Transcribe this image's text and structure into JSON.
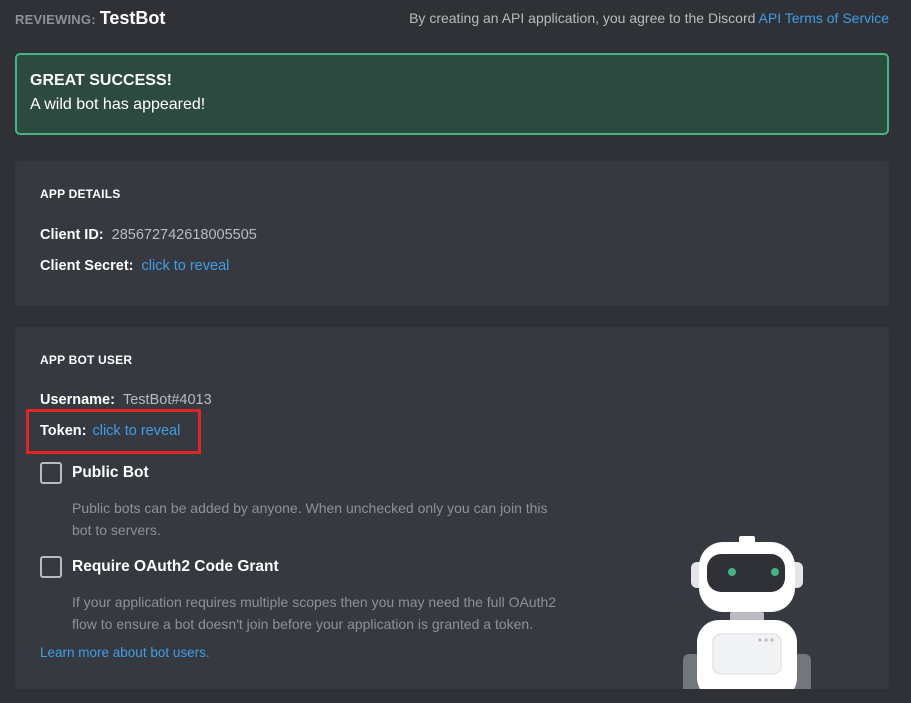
{
  "header": {
    "reviewing_label": "REVIEWING:",
    "app_name": "TestBot",
    "notice_prefix": "By creating an API application, you agree to the Discord",
    "terms_link": "API Terms of Service"
  },
  "success": {
    "title": "GREAT SUCCESS!",
    "message": "A wild bot has appeared!"
  },
  "app_details": {
    "title": "APP DETAILS",
    "client_id_label": "Client ID:",
    "client_id_value": "285672742618005505",
    "client_secret_label": "Client Secret:",
    "client_secret_link": "click to reveal"
  },
  "bot_user": {
    "title": "APP BOT USER",
    "username_label": "Username:",
    "username_value": "TestBot#4013",
    "token_label": "Token:",
    "token_link": "click to reveal",
    "public_bot_label": "Public Bot",
    "public_bot_desc": "Public bots can be added by anyone. When unchecked only you can join this bot to servers.",
    "oauth_label": "Require OAuth2 Code Grant",
    "oauth_desc": "If your application requires multiple scopes then you may need the full OAuth2 flow to ensure a bot doesn't join before your application is granted a token.",
    "learn_more_link": "Learn more about bot users."
  },
  "colors": {
    "background": "#2f3136",
    "card": "#36393f",
    "success_border": "#43b581",
    "link": "#3f9fe6",
    "highlight": "#e22424"
  }
}
